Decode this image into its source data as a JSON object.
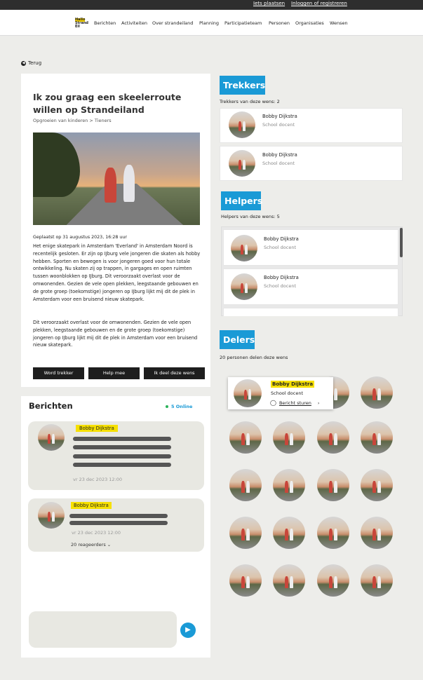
{
  "topbar": {
    "post_link": "Iets plaatsen",
    "login_link": "Inloggen of registreren"
  },
  "logo": {
    "line1": "Hallo",
    "line2": "Strand",
    "line3": "Eil"
  },
  "nav": [
    "Berichten",
    "Activiteiten",
    "Over strandeiland",
    "Planning",
    "Participatieteam",
    "Personen",
    "Organisaties",
    "Wensen"
  ],
  "back_label": "Terug",
  "wish": {
    "title": "Ik zou graag een skeelerroute willen op Strandeiland",
    "breadcrumb": "Opgroeien van kinderen > Tieners",
    "posted": "Geplaatst op 31 augustus 2023, 16:28 uur",
    "paragraph1": "Het enige skatepark in Amsterdam 'Everland' in Amsterdam Noord is recentelijk gesloten. Er zijn op IJburg vele jongeren die skaten als hobby hebben. Sporten en bewegen is voor jongeren goed voor hun totale ontwikkeling. Nu skaten zij op trappen, in gargages en open ruimten tussen woonblokken op IJburg. Dit veroorzaakt overlast voor de omwonenden. Gezien de vele open plekken, leegstaande gebouwen en de grote groep (toekomstige) jongeren op IJburg lijkt mij dit de plek in Amsterdam voor een bruisend nieuw skatepark.",
    "paragraph2": "Dit veroorzaakt overlast voor de omwonenden. Gezien de vele open plekken, leegstaande gebouwen en de grote groep (toekomstige) jongeren op IJburg lijkt mij dit de plek in Amsterdam voor een bruisend nieuw skatepark.",
    "buttons": {
      "puller": "Word trekker",
      "help": "Help mee",
      "share": "Ik deel deze wens"
    }
  },
  "messages": {
    "title": "Berichten",
    "online": "5 Online",
    "items": [
      {
        "author": "Bobby Dijkstra",
        "date": "vr 23 dec 2023 12:00"
      },
      {
        "author": "Bobby Dijkstra",
        "date": "vr 23 dec 2023 12:00",
        "replies": "20 reageerders"
      }
    ]
  },
  "trekkers": {
    "heading": "Trekkers",
    "caption": "Trekkers van deze wens: 2",
    "people": [
      {
        "name": "Bobby Dijkstra",
        "role": "School docent"
      },
      {
        "name": "Bobby Dijkstra",
        "role": "School docent"
      }
    ]
  },
  "helpers": {
    "heading": "Helpers",
    "caption": "Helpers van deze wens: 5",
    "people": [
      {
        "name": "Bobby Dijkstra",
        "role": "School docent"
      },
      {
        "name": "Bobby Dijkstra",
        "role": "School docent"
      }
    ]
  },
  "delers": {
    "heading": "Delers",
    "caption": "20 personen delen deze wens",
    "popup": {
      "name": "Bobby Dijkstra",
      "role": "School docent",
      "action": "Bericht sturen"
    }
  },
  "colors": {
    "accent": "#1a9ad6",
    "highlight": "#f6e000",
    "dark": "#1e1e1e",
    "background": "#ededea"
  }
}
